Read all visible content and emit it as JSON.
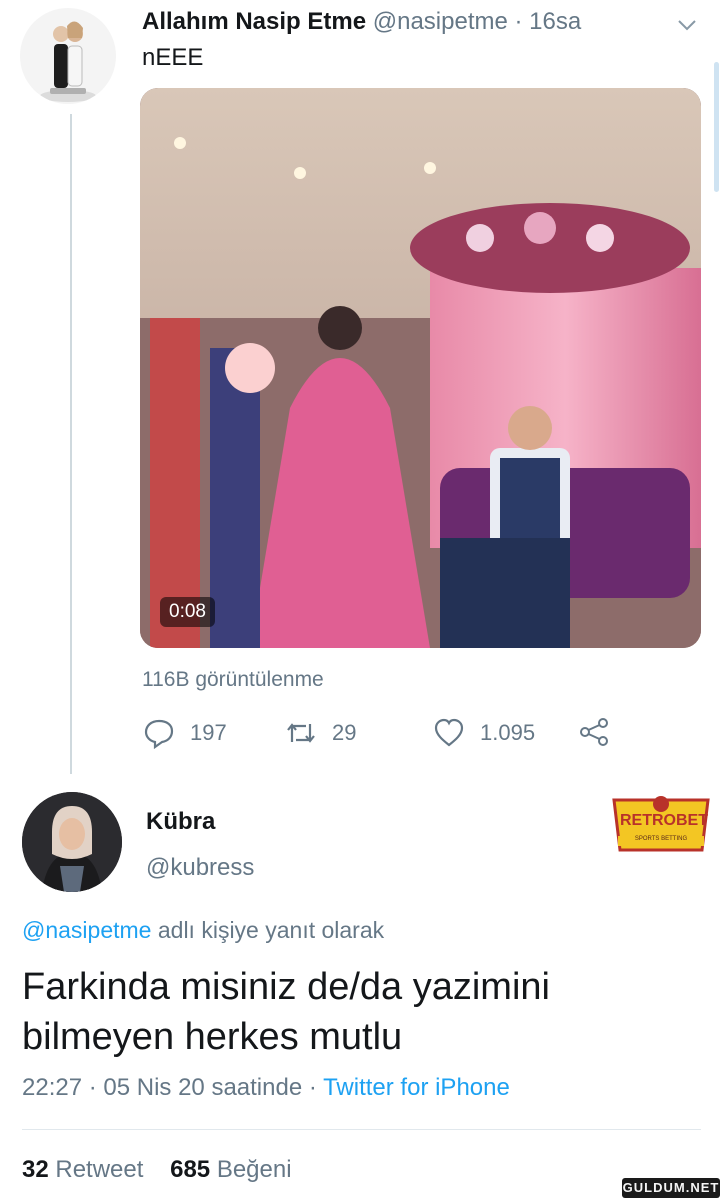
{
  "tweet": {
    "author_name": "Allahım Nasip Etme",
    "handle": "@nasipetme",
    "separator": " · ",
    "time_ago": "16sa",
    "text": "nEEE",
    "video_duration": "0:08",
    "views": "116B görüntülenme",
    "reply_count": "197",
    "retweet_count": "29",
    "like_count": "1.095"
  },
  "reply": {
    "author_name": "Kübra",
    "handle": "@kubress",
    "replying_handle": "@nasipetme",
    "replying_suffix": " adlı kişiye yanıt olarak",
    "text": "Farkinda misiniz de/da yazimini bilmeyen herkes mutlu",
    "timestamp": "22:27 · 05 Nis 20 saatinde · ",
    "source": "Twitter for iPhone",
    "retweets": "32",
    "retweets_label": "Retweet",
    "likes": "685",
    "likes_label": "Beğeni"
  },
  "ad_badge": {
    "brand": "RETROBET",
    "tagline": "SPORTS BETTING"
  },
  "watermark": "GULDUM.NET",
  "colors": {
    "link": "#1da1f2",
    "secondary": "#657786",
    "text": "#14171a"
  }
}
